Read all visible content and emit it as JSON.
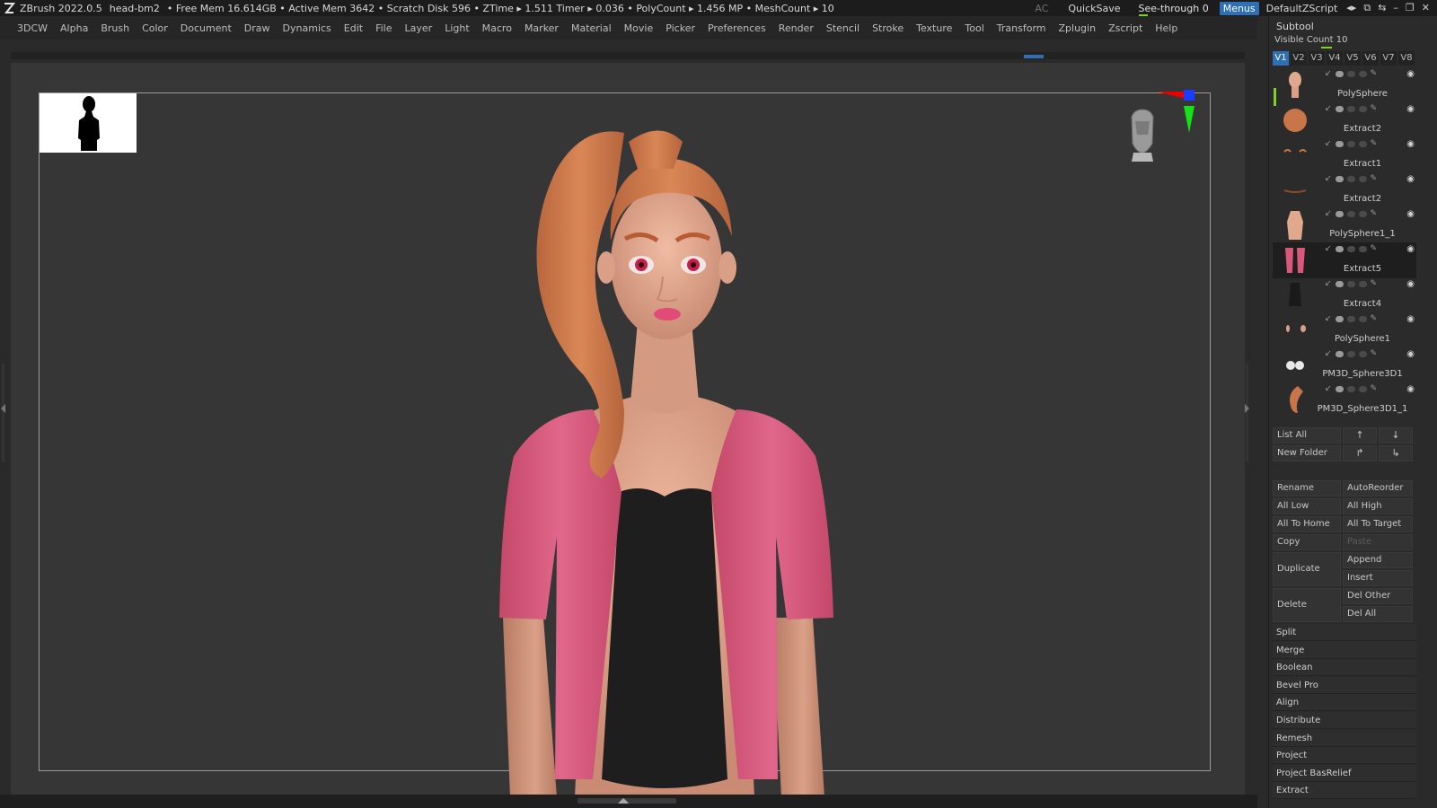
{
  "title_bar": {
    "app": "ZBrush 2022.0.5",
    "file": "head-bm2",
    "stats": "• Free Mem 16.614GB • Active Mem 3642 • Scratch Disk 596 • ZTime ▸ 1.511 Timer ▸ 0.036 • PolyCount ▸ 1.456 MP • MeshCount ▸ 10",
    "ac": "AC",
    "quicksave": "QuickSave",
    "see_through": "See-through  0",
    "menus": "Menus",
    "default_script": "DefaultZScript"
  },
  "menu_bar": [
    "3DCW",
    "Alpha",
    "Brush",
    "Color",
    "Document",
    "Draw",
    "Dynamics",
    "Edit",
    "File",
    "Layer",
    "Light",
    "Macro",
    "Marker",
    "Material",
    "Movie",
    "Picker",
    "Preferences",
    "Render",
    "Stencil",
    "Stroke",
    "Texture",
    "Tool",
    "Transform",
    "Zplugin",
    "Zscript",
    "Help"
  ],
  "subtool": {
    "title": "Subtool",
    "visible_count": "Visible Count 10",
    "tabs": [
      "V1",
      "V2",
      "V3",
      "V4",
      "V5",
      "V6",
      "V7",
      "V8"
    ],
    "active_tab": "V1",
    "items": [
      {
        "name": "PolySphere",
        "thumb": "head-thumb"
      },
      {
        "name": "Extract2",
        "thumb": "hair-thumb"
      },
      {
        "name": "Extract1",
        "thumb": "brows-thumb"
      },
      {
        "name": "Extract2",
        "thumb": "lashes-thumb"
      },
      {
        "name": "PolySphere1_1",
        "thumb": "body-thumb"
      },
      {
        "name": "Extract5",
        "thumb": "jacket-thumb"
      },
      {
        "name": "Extract4",
        "thumb": "top-thumb"
      },
      {
        "name": "PolySphere1",
        "thumb": "ears-thumb"
      },
      {
        "name": "PM3D_Sphere3D1",
        "thumb": "eyes-thumb"
      },
      {
        "name": "PM3D_Sphere3D1_1",
        "thumb": "ponytail-thumb"
      }
    ],
    "selected_index": 5,
    "list_all": "List All",
    "new_folder": "New Folder",
    "buttons": {
      "rename": "Rename",
      "autoreorder": "AutoReorder",
      "all_low": "All Low",
      "all_high": "All High",
      "all_to_home": "All To Home",
      "all_to_target": "All To Target",
      "copy": "Copy",
      "paste": "Paste",
      "duplicate": "Duplicate",
      "append": "Append",
      "insert": "Insert",
      "delete": "Delete",
      "del_other": "Del Other",
      "del_all": "Del All"
    },
    "sections": [
      "Split",
      "Merge",
      "Boolean",
      "Bevel Pro",
      "Align",
      "Distribute",
      "Remesh",
      "Project",
      "Project BasRelief",
      "Extract"
    ]
  },
  "colors": {
    "accent_blue": "#2f6fb6",
    "accent_green": "#7fd21f",
    "hair": "#c8754a",
    "skin": "#e0a88d",
    "jacket": "#d9577a",
    "top": "#1e1e1e"
  }
}
